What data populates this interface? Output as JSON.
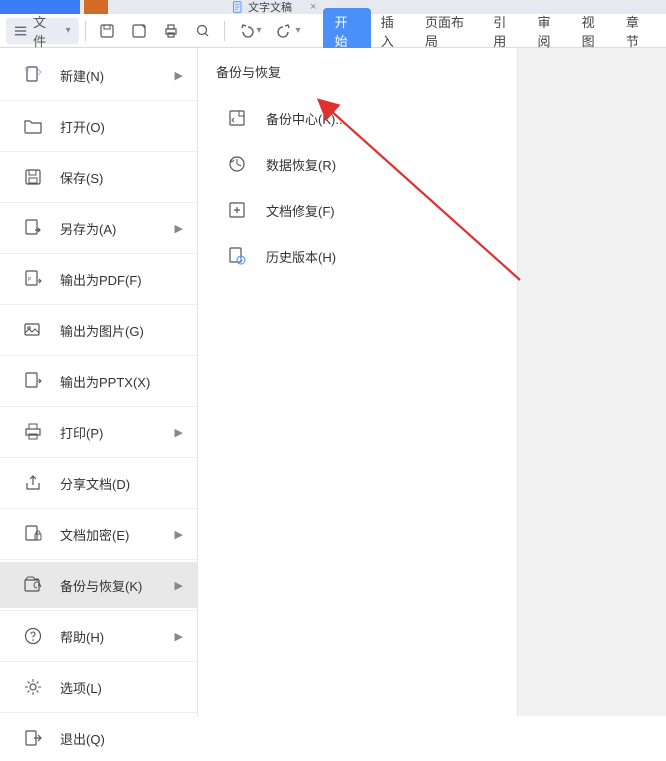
{
  "tabs": {
    "file_icon_color": "#d36a26",
    "doc_tab_label": "文字文稿",
    "doc_tab_close": "×"
  },
  "qa": {
    "file_label": "文件"
  },
  "ribbon": {
    "start": "开始",
    "insert": "插入",
    "page_layout": "页面布局",
    "references": "引用",
    "review": "审阅",
    "view": "视图",
    "chapter": "章节"
  },
  "file_menu": {
    "new": "新建(N)",
    "open": "打开(O)",
    "save": "保存(S)",
    "save_as": "另存为(A)",
    "export_pdf": "输出为PDF(F)",
    "export_image": "输出为图片(G)",
    "export_pptx": "输出为PPTX(X)",
    "print": "打印(P)",
    "share": "分享文档(D)",
    "encrypt": "文档加密(E)",
    "backup": "备份与恢复(K)",
    "help": "帮助(H)",
    "options": "选项(L)",
    "exit": "退出(Q)"
  },
  "submenu": {
    "title": "备份与恢复",
    "items": {
      "backup_center": "备份中心(K)...",
      "data_recovery": "数据恢复(R)",
      "doc_repair": "文档修复(F)",
      "history": "历史版本(H)"
    }
  }
}
